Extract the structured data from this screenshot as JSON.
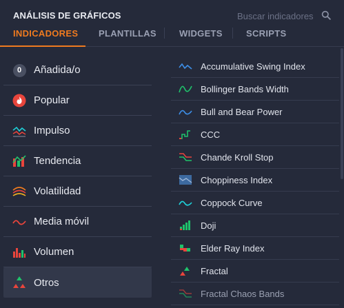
{
  "header": {
    "title": "ANÁLISIS DE GRÁFICOS",
    "search_placeholder": "Buscar indicadores"
  },
  "tabs": [
    {
      "label": "INDICADORES",
      "active": true
    },
    {
      "label": "PLANTILLAS",
      "active": false
    },
    {
      "label": "WIDGETS",
      "active": false
    },
    {
      "label": "SCRIPTS",
      "active": false
    }
  ],
  "categories": [
    {
      "label": "Añadida/o",
      "icon": "count-badge-icon",
      "badge": "0"
    },
    {
      "label": "Popular",
      "icon": "flame-icon"
    },
    {
      "label": "Impulso",
      "icon": "momentum-icon"
    },
    {
      "label": "Tendencia",
      "icon": "trend-icon"
    },
    {
      "label": "Volatilidad",
      "icon": "volatility-icon"
    },
    {
      "label": "Media móvil",
      "icon": "moving-average-icon"
    },
    {
      "label": "Volumen",
      "icon": "volume-icon"
    },
    {
      "label": "Otros",
      "icon": "others-icon",
      "active": true
    }
  ],
  "indicators": [
    {
      "label": "Accumulative Swing Index",
      "icon": "swing-index-icon"
    },
    {
      "label": "Bollinger Bands Width",
      "icon": "bollinger-width-icon"
    },
    {
      "label": "Bull and Bear Power",
      "icon": "bull-bear-icon"
    },
    {
      "label": "CCC",
      "icon": "ccc-icon"
    },
    {
      "label": "Chande Kroll Stop",
      "icon": "chande-kroll-icon"
    },
    {
      "label": "Choppiness Index",
      "icon": "choppiness-icon"
    },
    {
      "label": "Coppock Curve",
      "icon": "coppock-icon"
    },
    {
      "label": "Doji",
      "icon": "doji-icon"
    },
    {
      "label": "Elder Ray Index",
      "icon": "elder-ray-icon"
    },
    {
      "label": "Fractal",
      "icon": "fractal-icon"
    },
    {
      "label": "Fractal Chaos Bands",
      "icon": "fractal-chaos-icon"
    }
  ],
  "colors": {
    "accent": "#f07b1f",
    "background": "#252a3a",
    "blue": "#3d8fe8",
    "green": "#1fc26b",
    "red": "#e8453c",
    "teal": "#1fd0d8"
  }
}
